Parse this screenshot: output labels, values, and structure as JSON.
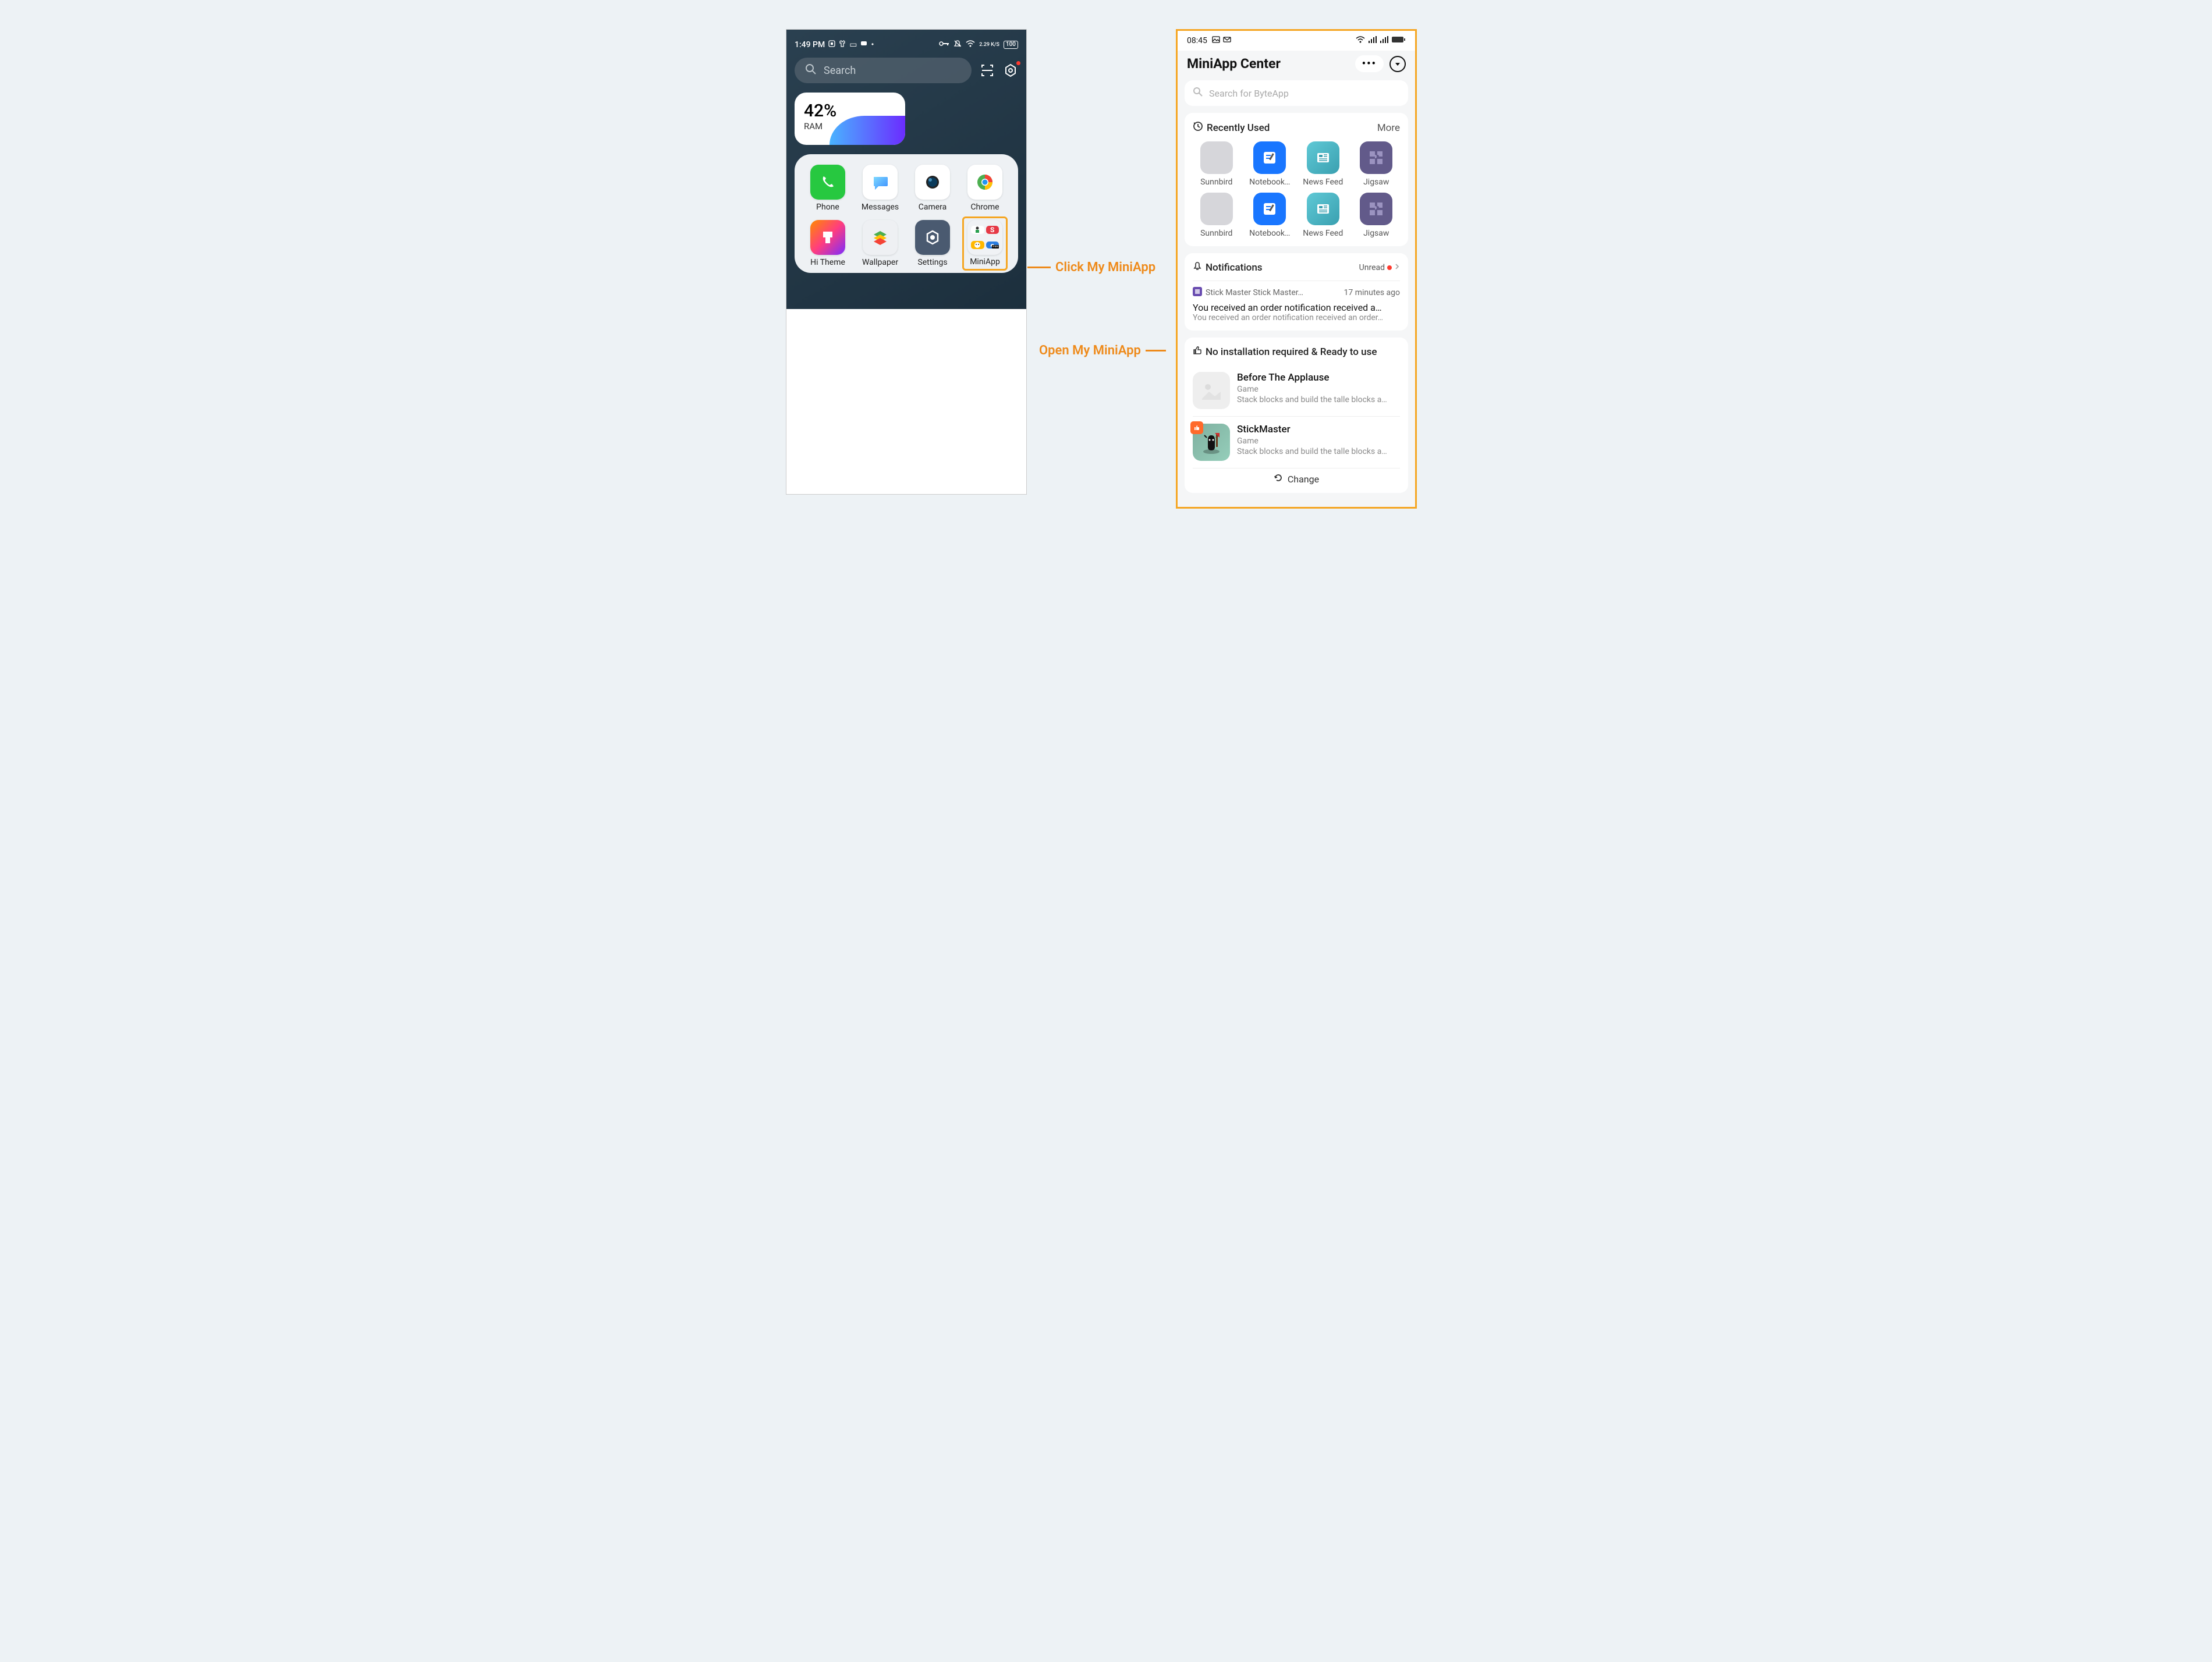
{
  "left_phone": {
    "status": {
      "time": "1:49 PM",
      "net_speed": "2.29 K/S",
      "battery": "100"
    },
    "search_placeholder": "Search",
    "ram_widget": {
      "percent": "42%",
      "label": "RAM"
    },
    "apps": [
      {
        "name": "Phone"
      },
      {
        "name": "Messages"
      },
      {
        "name": "Camera"
      },
      {
        "name": "Chrome"
      },
      {
        "name": "Hi Theme"
      },
      {
        "name": "Wallpaper"
      },
      {
        "name": "Settings"
      },
      {
        "name": "MiniApp"
      }
    ]
  },
  "annotations": {
    "click": "Click My MiniApp",
    "open": "Open My MiniApp"
  },
  "right_phone": {
    "status_time": "08:45",
    "title": "MiniApp Center",
    "search_placeholder": "Search for ByteApp",
    "recent": {
      "header": "Recently Used",
      "more": "More",
      "row1": [
        {
          "name": "Sunnbird"
        },
        {
          "name": "Notebook…"
        },
        {
          "name": "News Feed"
        },
        {
          "name": "Jigsaw"
        }
      ],
      "row2": [
        {
          "name": "Sunnbird"
        },
        {
          "name": "Notebook…"
        },
        {
          "name": "News Feed"
        },
        {
          "name": "Jigsaw"
        }
      ]
    },
    "notifications": {
      "header": "Notifications",
      "unread_label": "Unread",
      "item": {
        "app": "Stick Master Stick Master…",
        "time": "17 minutes ago",
        "title": "You received an order notification received a…",
        "sub": "You received an order notification received an order…"
      }
    },
    "ready": {
      "header": "No installation required & Ready to use",
      "items": [
        {
          "name": "Before The Applause",
          "category": "Game",
          "desc": "Stack blocks and build the talle blocks a…"
        },
        {
          "name": "StickMaster",
          "category": "Game",
          "desc": "Stack blocks and build the talle blocks a…"
        }
      ],
      "change": "Change"
    }
  }
}
